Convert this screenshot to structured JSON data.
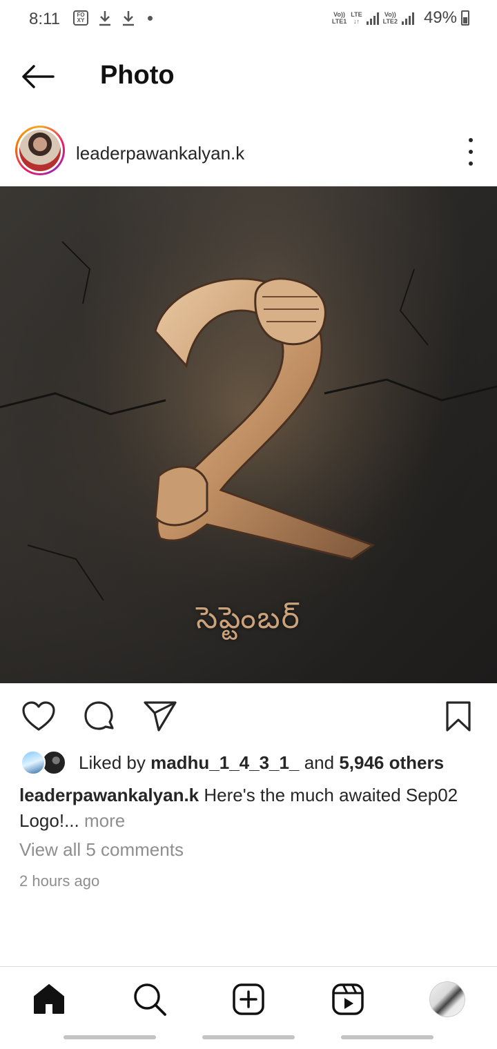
{
  "status_bar": {
    "time": "8:11",
    "app_badge": "FO XY",
    "net1_top": "Vo))",
    "net1_mid": "LTE1",
    "net2_top": "LTE",
    "net3_top": "Vo))",
    "net3_mid": "LTE2",
    "battery": "49%"
  },
  "header": {
    "title": "Photo",
    "back_icon": "arrow-left-icon"
  },
  "post": {
    "username": "leaderpawankalyan.k",
    "image_text": "సెప్టెంబర్",
    "likes": {
      "prefix": "Liked by",
      "user": "madhu_1_4_3_1_",
      "middle": "and",
      "count": "5,946 others"
    },
    "caption": {
      "user": "leaderpawankalyan.k",
      "text": "Here's the much awaited Sep02 Logo!...",
      "more": "more"
    },
    "view_comments": "View all 5 comments",
    "timestamp": "2 hours ago"
  },
  "actions": [
    "heart-icon",
    "comment-icon",
    "share-icon",
    "bookmark-icon"
  ],
  "nav": [
    "home-icon",
    "search-icon",
    "add-post-icon",
    "reels-icon",
    "profile-avatar"
  ],
  "colors": {
    "text": "#262626",
    "muted": "#8e8e8e",
    "divider": "#dbdbdb",
    "image_gold": "#caa27c"
  }
}
